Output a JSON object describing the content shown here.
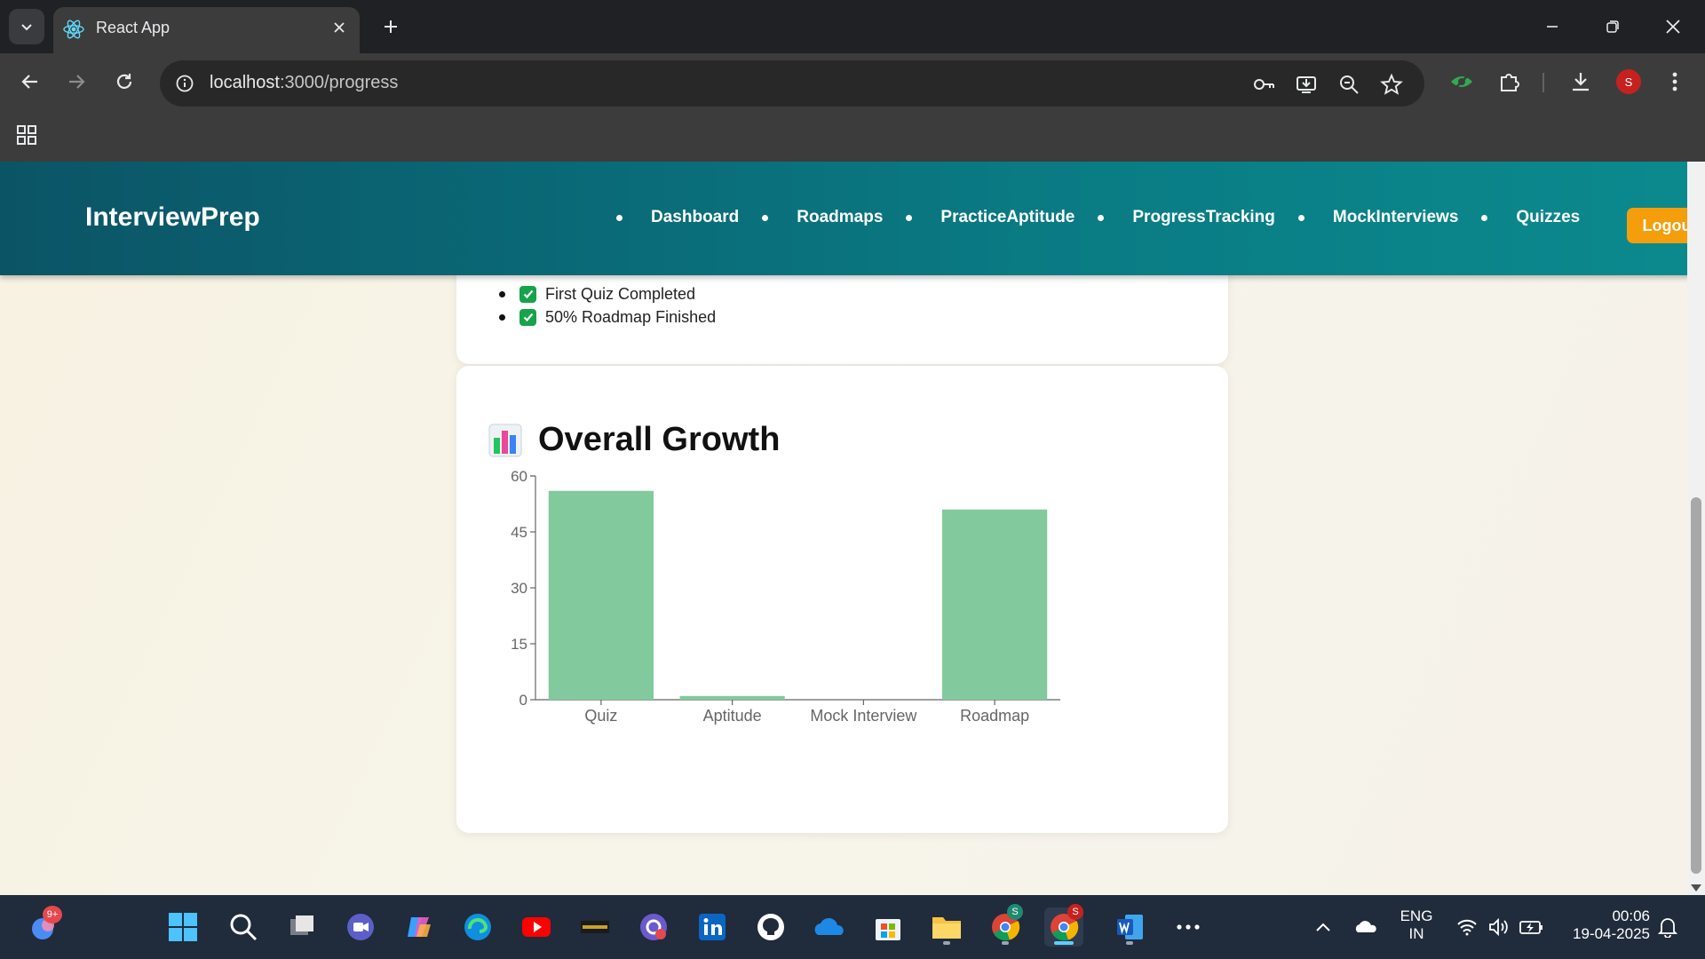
{
  "browser": {
    "tab_title": "React App",
    "url_host": "localhost",
    "url_path": ":3000/progress",
    "profile_initial": "S"
  },
  "header": {
    "brand": "InterviewPrep",
    "nav_items": [
      "Dashboard",
      "Roadmaps",
      "PracticeAptitude",
      "ProgressTracking",
      "MockInterviews",
      "Quizzes"
    ],
    "logout_label": "Logout"
  },
  "achievements": {
    "items": [
      "First Quiz Completed",
      "50% Roadmap Finished"
    ]
  },
  "growth": {
    "title": "Overall Growth",
    "icon": "bar-chart-emoji"
  },
  "chart_data": {
    "type": "bar",
    "categories": [
      "Quiz",
      "Aptitude",
      "Mock Interview",
      "Roadmap"
    ],
    "values": [
      56,
      1,
      0,
      51
    ],
    "ylim": [
      0,
      60
    ],
    "yticks": [
      0,
      15,
      30,
      45,
      60
    ],
    "bar_color": "#82ca9d",
    "grid": false
  },
  "taskbar": {
    "notification_badge": "9+",
    "language_line1": "ENG",
    "language_line2": "IN",
    "time": "00:06",
    "date": "19-04-2025",
    "chrome_badge_1": "S",
    "chrome_badge_2": "S"
  },
  "colors": {
    "header_gradient_start": "#0b5466",
    "header_gradient_end": "#0b8a8e",
    "logout": "#f59e0b",
    "check": "#16a34a"
  }
}
